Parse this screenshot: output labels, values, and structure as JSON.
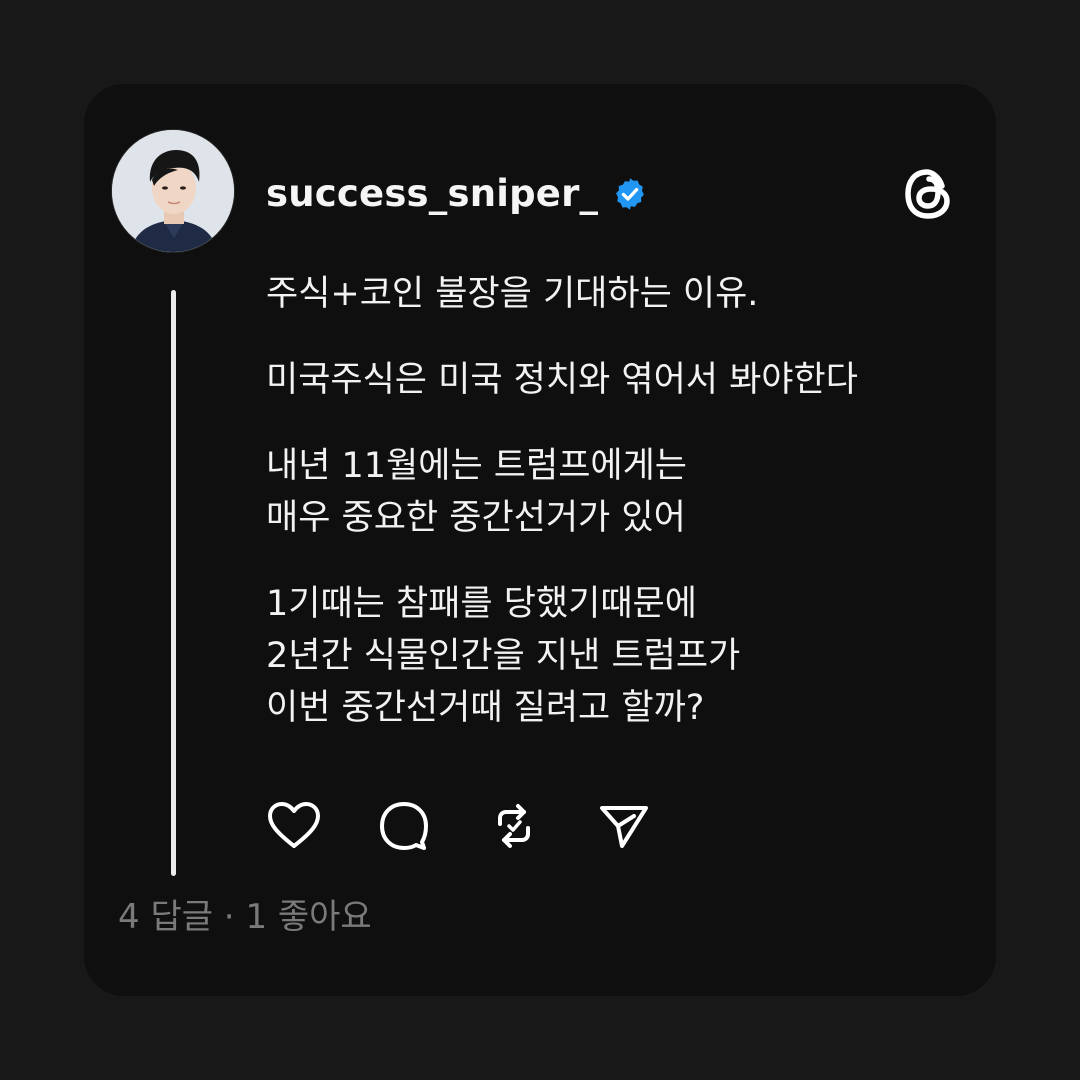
{
  "post": {
    "username": "success_sniper_",
    "verified": true,
    "paragraphs": [
      [
        "주식+코인 불장을 기대하는 이유."
      ],
      [
        "미국주식은 미국 정치와 엮어서 봐야한다"
      ],
      [
        "내년 11월에는 트럼프에게는",
        "매우 중요한 중간선거가 있어"
      ],
      [
        "1기때는 참패를 당했기때문에",
        "2년간 식물인간을 지낸 트럼프가",
        "이번 중간선거때 질려고 할까?"
      ]
    ],
    "stats": {
      "replies": "4 답글",
      "separator": " · ",
      "likes": "1 좋아요"
    }
  },
  "icons": {
    "verified": "verified-badge-icon",
    "logo": "threads-logo-icon",
    "like": "heart-icon",
    "reply": "comment-bubble-icon",
    "repost": "repost-icon",
    "share": "send-icon"
  },
  "colors": {
    "background": "#181818",
    "card": "#0f0f0f",
    "text": "#f2f2f2",
    "muted": "#7a7a7a",
    "verified": "#2196f3"
  }
}
